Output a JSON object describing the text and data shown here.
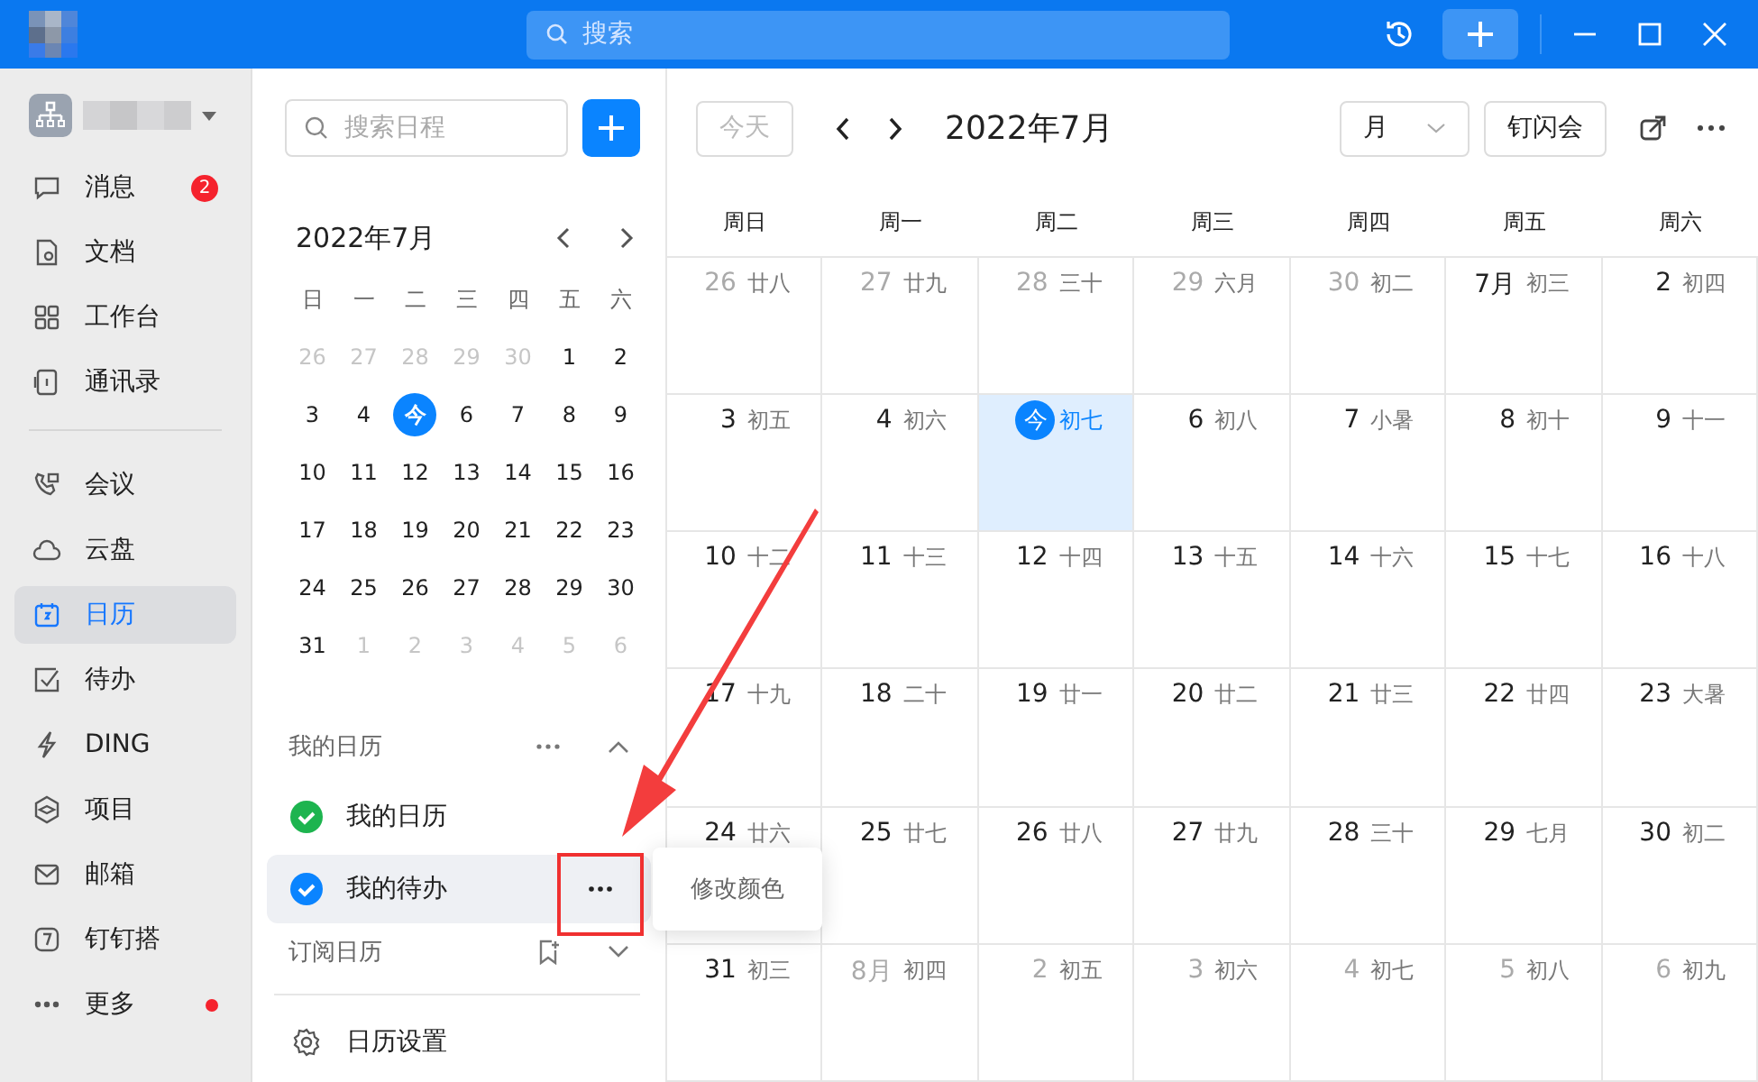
{
  "titlebar": {
    "search_placeholder": "搜索"
  },
  "sidebar": {
    "sections": [
      [
        {
          "label": "消息",
          "selected": false,
          "badge": "2",
          "dot": false
        },
        {
          "label": "文档",
          "selected": false,
          "dot": false
        },
        {
          "label": "工作台",
          "selected": false,
          "dot": false
        },
        {
          "label": "通讯录",
          "selected": false,
          "dot": false
        }
      ],
      [
        {
          "label": "会议",
          "selected": false,
          "dot": false
        },
        {
          "label": "云盘",
          "selected": false,
          "dot": false
        },
        {
          "label": "日历",
          "selected": true,
          "dot": false
        },
        {
          "label": "待办",
          "selected": false,
          "dot": false
        },
        {
          "label": "DING",
          "selected": false,
          "dot": false
        },
        {
          "label": "项目",
          "selected": false,
          "dot": false
        },
        {
          "label": "邮箱",
          "selected": false,
          "dot": false
        },
        {
          "label": "钉钉搭",
          "selected": false,
          "dot": false
        },
        {
          "label": "更多",
          "selected": false,
          "dot": true
        }
      ]
    ]
  },
  "panel": {
    "search_placeholder": "搜索日程",
    "mini_calendar": {
      "title": "2022年7月",
      "weekdays": [
        "日",
        "一",
        "二",
        "三",
        "四",
        "五",
        "六"
      ],
      "weeks": [
        [
          {
            "day": "26",
            "muted": true
          },
          {
            "day": "27",
            "muted": true
          },
          {
            "day": "28",
            "muted": true
          },
          {
            "day": "29",
            "muted": true
          },
          {
            "day": "30",
            "muted": true
          },
          {
            "day": "1",
            "muted": false
          },
          {
            "day": "2",
            "muted": false
          }
        ],
        [
          {
            "day": "3",
            "muted": false
          },
          {
            "day": "4",
            "muted": false
          },
          {
            "day": "今",
            "today": true
          },
          {
            "day": "6",
            "muted": false
          },
          {
            "day": "7",
            "muted": false
          },
          {
            "day": "8",
            "muted": false
          },
          {
            "day": "9",
            "muted": false
          }
        ],
        [
          {
            "day": "10",
            "muted": false
          },
          {
            "day": "11",
            "muted": false
          },
          {
            "day": "12",
            "muted": false
          },
          {
            "day": "13",
            "muted": false
          },
          {
            "day": "14",
            "muted": false
          },
          {
            "day": "15",
            "muted": false
          },
          {
            "day": "16",
            "muted": false
          }
        ],
        [
          {
            "day": "17",
            "muted": false
          },
          {
            "day": "18",
            "muted": false
          },
          {
            "day": "19",
            "muted": false
          },
          {
            "day": "20",
            "muted": false
          },
          {
            "day": "21",
            "muted": false
          },
          {
            "day": "22",
            "muted": false
          },
          {
            "day": "23",
            "muted": false
          }
        ],
        [
          {
            "day": "24",
            "muted": false
          },
          {
            "day": "25",
            "muted": false
          },
          {
            "day": "26",
            "muted": false
          },
          {
            "day": "27",
            "muted": false
          },
          {
            "day": "28",
            "muted": false
          },
          {
            "day": "29",
            "muted": false
          },
          {
            "day": "30",
            "muted": false
          }
        ],
        [
          {
            "day": "31",
            "muted": false
          },
          {
            "day": "1",
            "muted": true
          },
          {
            "day": "2",
            "muted": true
          },
          {
            "day": "3",
            "muted": true
          },
          {
            "day": "4",
            "muted": true
          },
          {
            "day": "5",
            "muted": true
          },
          {
            "day": "6",
            "muted": true
          }
        ]
      ]
    },
    "my_calendars": {
      "title": "我的日历",
      "expanded": true,
      "items": [
        {
          "label": "我的日历",
          "color": "#1db44f",
          "checked": true,
          "selected": false
        },
        {
          "label": "我的待办",
          "color": "#0a84ff",
          "checked": true,
          "selected": true
        }
      ]
    },
    "subscribed": {
      "title": "订阅日历",
      "expanded": false
    },
    "settings": "日历设置",
    "context_menu": {
      "items": [
        "修改颜色"
      ]
    }
  },
  "main": {
    "today_button": {
      "label": "今天",
      "disabled": true
    },
    "title": "2022年7月",
    "view": "月",
    "meeting_button": "钉闪会",
    "weekdays": [
      "周日",
      "周一",
      "周二",
      "周三",
      "周四",
      "周五",
      "周六"
    ],
    "weeks": [
      [
        {
          "day": "26",
          "lunar": "廿八",
          "muted": true
        },
        {
          "day": "27",
          "lunar": "廿九",
          "muted": true
        },
        {
          "day": "28",
          "lunar": "三十",
          "muted": true
        },
        {
          "day": "29",
          "lunar": "六月",
          "muted": true
        },
        {
          "day": "30",
          "lunar": "初二",
          "muted": true
        },
        {
          "day": "7月",
          "lunar": "初三",
          "muted": false
        },
        {
          "day": "2",
          "lunar": "初四",
          "muted": false
        }
      ],
      [
        {
          "day": "3",
          "lunar": "初五",
          "muted": false
        },
        {
          "day": "4",
          "lunar": "初六",
          "muted": false
        },
        {
          "day": "今",
          "lunar": "初七",
          "today": true
        },
        {
          "day": "6",
          "lunar": "初八",
          "muted": false
        },
        {
          "day": "7",
          "lunar": "小暑",
          "muted": false
        },
        {
          "day": "8",
          "lunar": "初十",
          "muted": false
        },
        {
          "day": "9",
          "lunar": "十一",
          "muted": false
        }
      ],
      [
        {
          "day": "10",
          "lunar": "十二",
          "muted": false
        },
        {
          "day": "11",
          "lunar": "十三",
          "muted": false
        },
        {
          "day": "12",
          "lunar": "十四",
          "muted": false
        },
        {
          "day": "13",
          "lunar": "十五",
          "muted": false
        },
        {
          "day": "14",
          "lunar": "十六",
          "muted": false
        },
        {
          "day": "15",
          "lunar": "十七",
          "muted": false
        },
        {
          "day": "16",
          "lunar": "十八",
          "muted": false
        }
      ],
      [
        {
          "day": "17",
          "lunar": "十九",
          "muted": false
        },
        {
          "day": "18",
          "lunar": "二十",
          "muted": false
        },
        {
          "day": "19",
          "lunar": "廿一",
          "muted": false
        },
        {
          "day": "20",
          "lunar": "廿二",
          "muted": false
        },
        {
          "day": "21",
          "lunar": "廿三",
          "muted": false
        },
        {
          "day": "22",
          "lunar": "廿四",
          "muted": false
        },
        {
          "day": "23",
          "lunar": "大暑",
          "muted": false
        }
      ],
      [
        {
          "day": "24",
          "lunar": "廿六",
          "muted": false
        },
        {
          "day": "25",
          "lunar": "廿七",
          "muted": false
        },
        {
          "day": "26",
          "lunar": "廿八",
          "muted": false
        },
        {
          "day": "27",
          "lunar": "廿九",
          "muted": false
        },
        {
          "day": "28",
          "lunar": "三十",
          "muted": false
        },
        {
          "day": "29",
          "lunar": "七月",
          "muted": false
        },
        {
          "day": "30",
          "lunar": "初二",
          "muted": false
        }
      ],
      [
        {
          "day": "31",
          "lunar": "初三",
          "muted": false
        },
        {
          "day": "8月",
          "lunar": "初四",
          "muted": true
        },
        {
          "day": "2",
          "lunar": "初五",
          "muted": true
        },
        {
          "day": "3",
          "lunar": "初六",
          "muted": true
        },
        {
          "day": "4",
          "lunar": "初七",
          "muted": true
        },
        {
          "day": "5",
          "lunar": "初八",
          "muted": true
        },
        {
          "day": "6",
          "lunar": "初九",
          "muted": true
        }
      ]
    ]
  },
  "annotations": {
    "arrow": true,
    "highlight_box": true
  }
}
